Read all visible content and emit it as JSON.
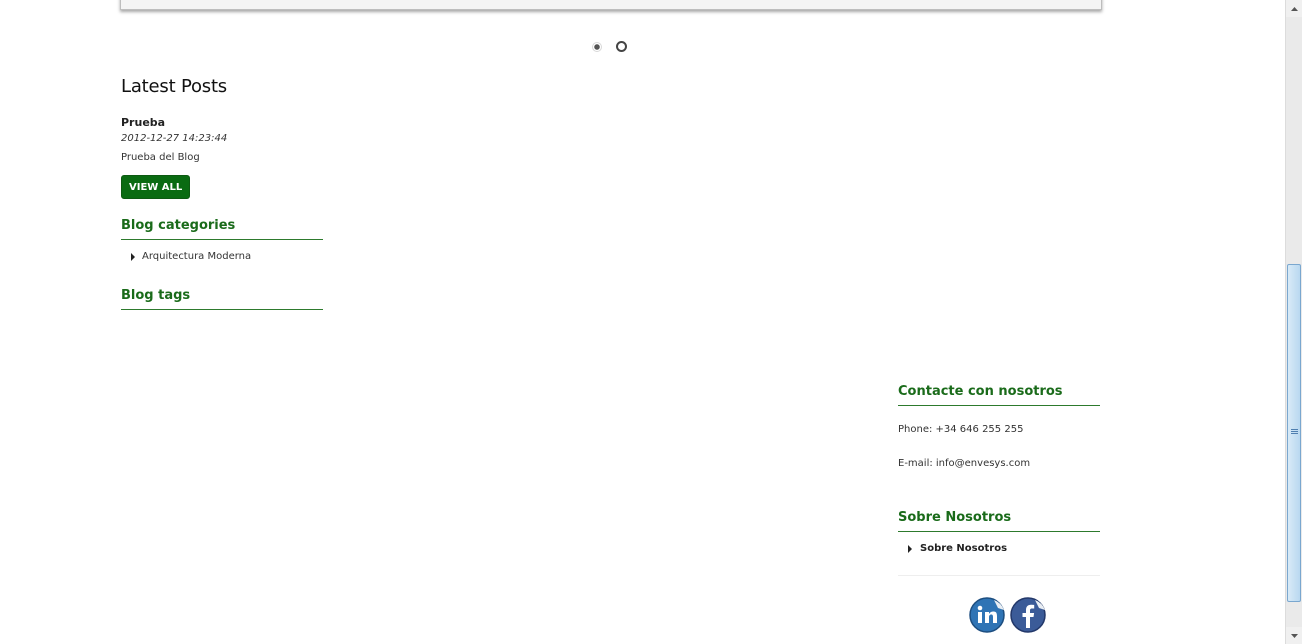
{
  "slider": {
    "pages": 2,
    "active_page": 2
  },
  "latest_posts": {
    "heading": "Latest Posts",
    "posts": [
      {
        "title": "Prueba",
        "date": "2012-12-27 14:23:44",
        "excerpt": "Prueba del Blog"
      }
    ],
    "view_all_label": "VIEW ALL"
  },
  "blog_categories": {
    "heading": "Blog categories",
    "items": [
      {
        "label": "Arquitectura Moderna"
      }
    ]
  },
  "blog_tags": {
    "heading": "Blog tags"
  },
  "contact": {
    "heading": "Contacte con nosotros",
    "phone": "Phone: +34 646 255 255",
    "email": "E-mail: info@envesys.com"
  },
  "about": {
    "heading": "Sobre Nosotros",
    "items": [
      {
        "label": "Sobre Nosotros"
      }
    ]
  },
  "social": {
    "icons": [
      "linkedin-icon",
      "facebook-icon"
    ]
  },
  "colors": {
    "accent_green": "#1a6b1a",
    "button_green": "#0a6b12",
    "scroll_thumb": "#b9d8f0"
  }
}
